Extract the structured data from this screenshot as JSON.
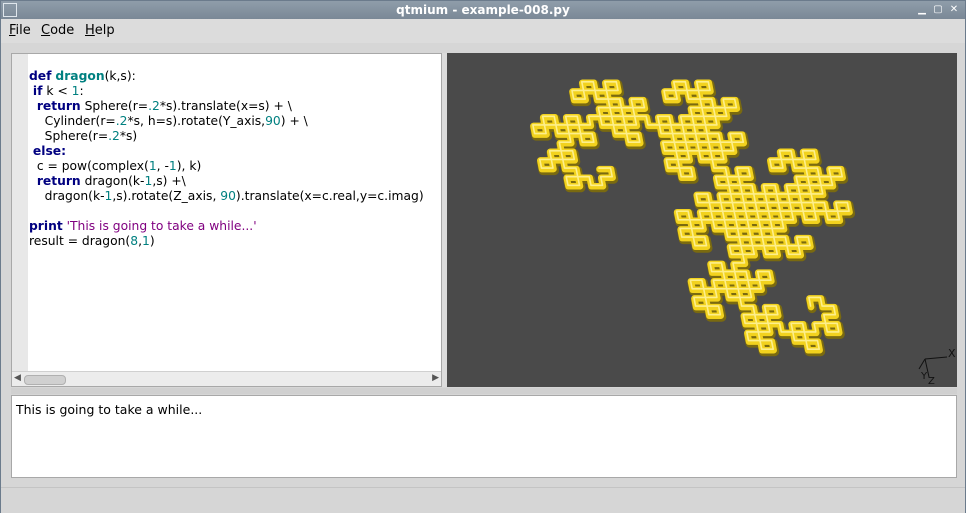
{
  "window": {
    "title": "qtmium - example-008.py"
  },
  "menubar": {
    "items": [
      {
        "label_ul": "F",
        "label_rest": "ile"
      },
      {
        "label_ul": "C",
        "label_rest": "ode"
      },
      {
        "label_ul": "H",
        "label_rest": "elp"
      }
    ]
  },
  "editor": {
    "lines": {
      "l1_kw": "def",
      "l1_fn": "dragon",
      "l1_rest": "(k,s):",
      "l2_kw": "if",
      "l2_a": " k < ",
      "l2_num": "1",
      "l2_b": ":",
      "l3_kw": "return",
      "l3_a": " Sphere(r=",
      "l3_n1": ".2",
      "l3_b": "*s).translate(x=s) + \\",
      "l4_a": "Cylinder(r=",
      "l4_n1": ".2",
      "l4_b": "*s, h=s).rotate(Y_axis,",
      "l4_n2": "90",
      "l4_c": ") + \\",
      "l5_a": "Sphere(r=",
      "l5_n1": ".2",
      "l5_b": "*s)",
      "l6_kw": "else:",
      "l7_a": "c = pow(complex(",
      "l7_n1": "1",
      "l7_b": ", -",
      "l7_n2": "1",
      "l7_c": "), k)",
      "l8_kw": "return",
      "l8_a": " dragon(k-",
      "l8_n1": "1",
      "l8_b": ",s) +\\",
      "l9_a": "dragon(k-",
      "l9_n1": "1",
      "l9_b": ",s).rotate(Z_axis, ",
      "l9_n2": "90",
      "l9_c": ").translate(x=c.real,y=c.imag)",
      "l11_kw": "print",
      "l11_str": " 'This is going to take a while...'",
      "l12_a": "result = dragon(",
      "l12_n1": "8",
      "l12_b": ",",
      "l12_n2": "1",
      "l12_c": ")"
    }
  },
  "viewport": {
    "axis_x": "X",
    "axis_y": "Y",
    "axis_z": "Z",
    "bg_color": "#4a4a4a",
    "shape_color": "#f2d21e"
  },
  "console": {
    "text": "This is going to take a while..."
  },
  "icons": {
    "window_menu": "window-menu-icon",
    "minimize": "minimize-icon",
    "maximize": "maximize-icon",
    "close": "close-icon"
  }
}
